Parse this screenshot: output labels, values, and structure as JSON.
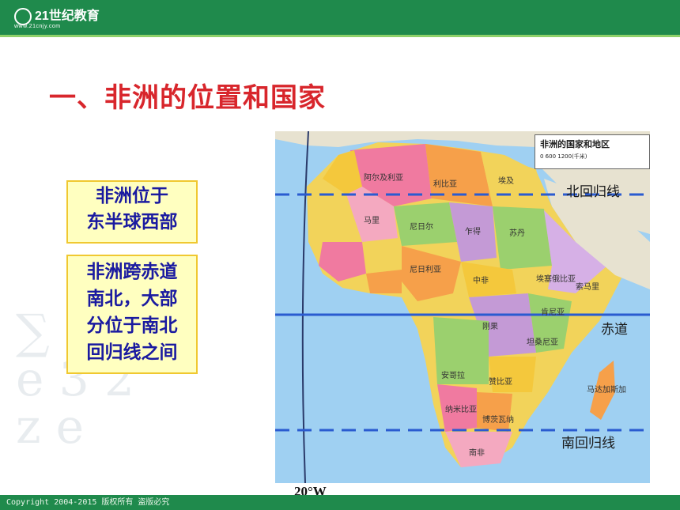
{
  "header": {
    "logo_text": "21世纪教育",
    "logo_sub": "www.21cnjy.com"
  },
  "slide": {
    "title": "一、非洲的位置和国家"
  },
  "boxes": {
    "box1": {
      "lines": [
        "非洲位于",
        "东半球西部"
      ]
    },
    "box2": {
      "lines": [
        "非洲跨赤道",
        "南北，大部",
        "分位于南北",
        "回归线之间"
      ]
    }
  },
  "map": {
    "legend_title": "非洲的国家和地区",
    "legend_scale": "0      600      1200(千米)",
    "labels": {
      "tropic_north": "北回归线",
      "equator": "赤道",
      "tropic_south": "南回归线"
    },
    "reference_line": "20°W",
    "country_labels": [
      "阿尔及利亚",
      "利比亚",
      "埃及",
      "马里",
      "尼日尔",
      "乍得",
      "苏丹",
      "尼日利亚",
      "中非",
      "埃塞俄比亚",
      "刚果",
      "安哥拉",
      "赞比亚",
      "纳米比亚",
      "南非",
      "马达加斯加",
      "坦桑尼亚",
      "肯尼亚",
      "索马里",
      "博茨瓦纳"
    ]
  },
  "footer": {
    "copyright": "Copyright 2004-2015 版权所有 盗版必究"
  }
}
